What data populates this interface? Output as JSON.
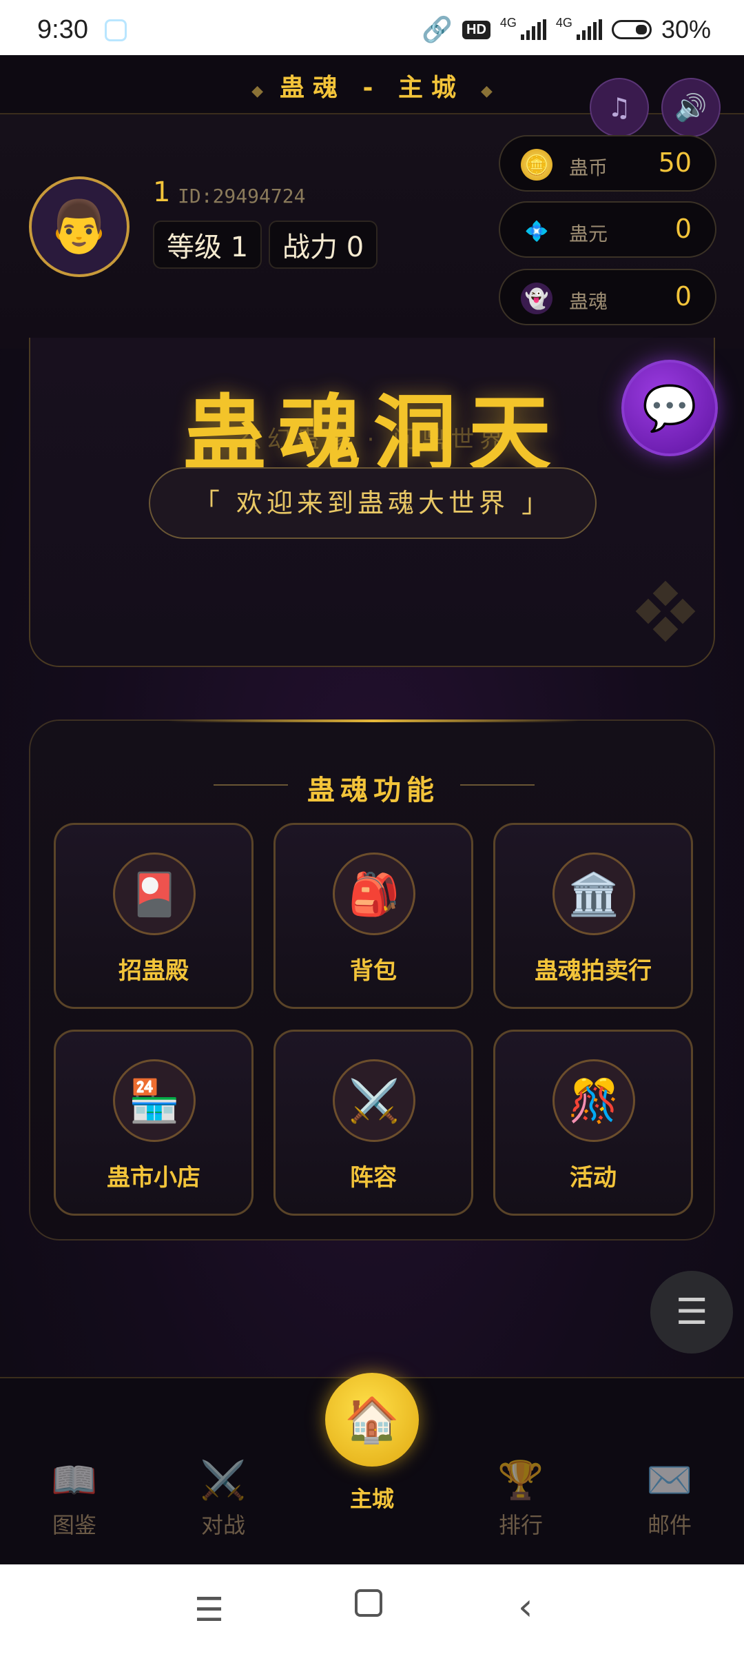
{
  "status_bar": {
    "time": "9:30",
    "hd": "HD",
    "net1": "4G",
    "net2": "4G",
    "battery": "30%"
  },
  "header": {
    "title": "蛊魂 - 主城",
    "music_icon": "music-note-icon",
    "sound_icon": "speaker-icon"
  },
  "player": {
    "name": "1",
    "id": "ID:29494724",
    "level": "等级 1",
    "power": "战力 0"
  },
  "currencies": [
    {
      "label": "蛊币",
      "value": "50",
      "icon": "coin-icon"
    },
    {
      "label": "蛊元",
      "value": "0",
      "icon": "crystal-icon"
    },
    {
      "label": "蛊魂",
      "value": "0",
      "icon": "ghost-icon"
    }
  ],
  "hero": {
    "title": "蛊魂洞天",
    "subtitle": "玄幻蛊修 · 问鼎世界",
    "welcome": "「 欢迎来到蛊魂大世界 」"
  },
  "features": {
    "title": "蛊魂功能",
    "items": [
      {
        "label": "招蛊殿",
        "icon": "card-icon"
      },
      {
        "label": "背包",
        "icon": "backpack-icon"
      },
      {
        "label": "蛊魂拍卖行",
        "icon": "auction-building-icon"
      },
      {
        "label": "蛊市小店",
        "icon": "shop-icon"
      },
      {
        "label": "阵容",
        "icon": "crossed-swords-icon"
      },
      {
        "label": "活动",
        "icon": "party-icon"
      }
    ]
  },
  "bottom_nav": {
    "items": [
      {
        "label": "图鉴",
        "icon": "book-icon"
      },
      {
        "label": "对战",
        "icon": "crossed-swords-icon"
      },
      {
        "label": "主城",
        "icon": "home-icon"
      },
      {
        "label": "排行",
        "icon": "trophy-icon"
      },
      {
        "label": "邮件",
        "icon": "mail-icon"
      }
    ]
  },
  "colors": {
    "accent_gold": "#f3c43a",
    "chat_purple": "#7a24c4",
    "background": "#140c1c"
  }
}
